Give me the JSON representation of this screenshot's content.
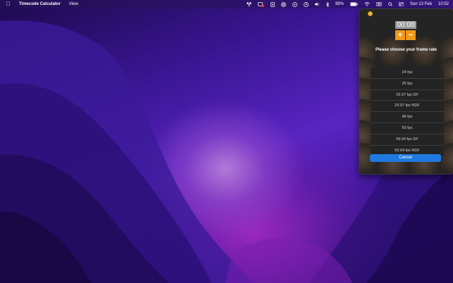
{
  "menubar": {
    "app_name": "Timecode Calculator",
    "menu_view": "View",
    "battery_percent": "99%",
    "date": "Sun 13 Feb",
    "time": "10:52"
  },
  "app": {
    "timecode": "00:00",
    "plus_label": "+",
    "minus_label": "−",
    "prompt": "Please choose your frame rate",
    "frame_rates": [
      "24 fps",
      "25 fps",
      "29.97 fps DF",
      "29.97 fps NDF",
      "48 fps",
      "50 fps",
      "59.94 fps DF",
      "59.94 fps NDF"
    ],
    "cancel_label": "Cancel"
  },
  "colors": {
    "accent_orange": "#f09a1a",
    "cancel_blue": "#1e7ae0",
    "window_bg": "#242424"
  }
}
